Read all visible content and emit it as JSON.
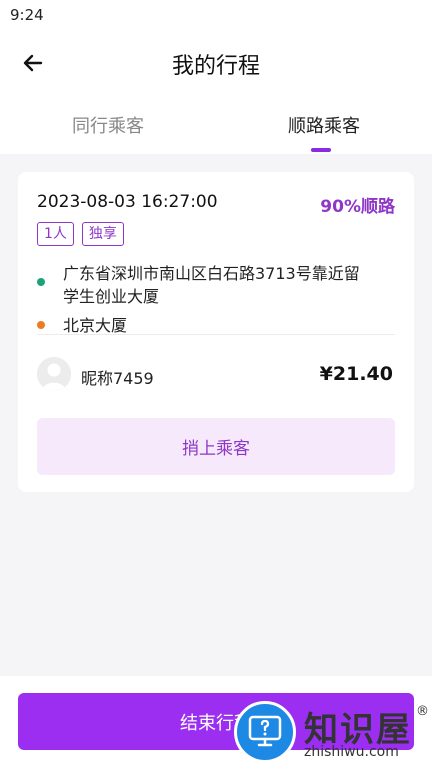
{
  "status_bar": {
    "time": "9:24"
  },
  "header": {
    "title": "我的行程"
  },
  "tabs": [
    {
      "label": "同行乘客",
      "active": false
    },
    {
      "label": "顺路乘客",
      "active": true
    }
  ],
  "trip": {
    "datetime": "2023-08-03 16:27:00",
    "match": "90%顺路",
    "badges": [
      "1人",
      "独享"
    ],
    "start_address_line1": "广东省深圳市南山区白石路3713号靠近留",
    "start_address_line2": "学生创业大厦",
    "end_address": "北京大厦",
    "passenger_name": "昵称7459",
    "price": "¥21.40",
    "pickup_label": "捎上乘客"
  },
  "bottom": {
    "end_trip_label": "结束行程"
  },
  "watermark": {
    "brand": "知识屋",
    "url": "zhishiwu.com",
    "mark": "®"
  },
  "colors": {
    "accent": "#9b2ef0",
    "accent_text": "#8e36c8",
    "start_dot": "#1aa37a",
    "end_dot": "#f07a1e"
  }
}
